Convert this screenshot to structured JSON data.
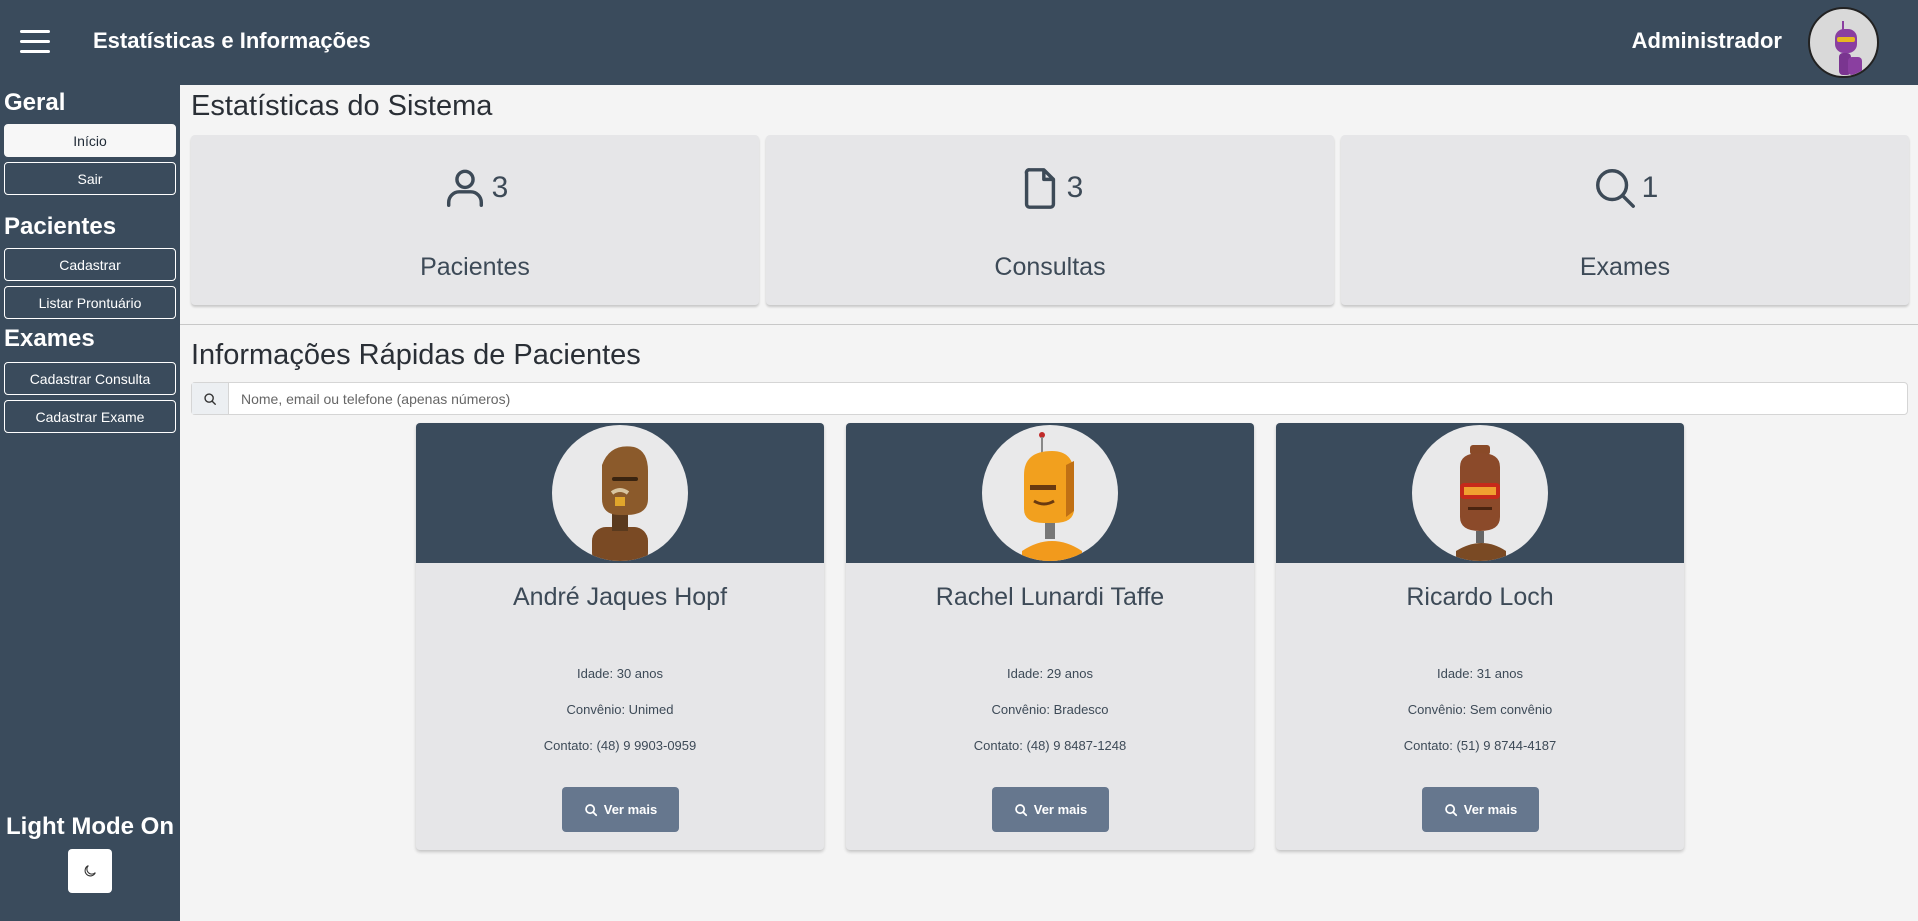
{
  "header": {
    "title": "Estatísticas e Informações",
    "user_name": "Administrador"
  },
  "sidebar": {
    "sections": [
      {
        "heading": "Geral",
        "items": [
          {
            "label": "Início",
            "active": true
          },
          {
            "label": "Sair"
          }
        ]
      },
      {
        "heading": "Pacientes",
        "items": [
          {
            "label": "Cadastrar"
          },
          {
            "label": "Listar Prontuário"
          }
        ]
      },
      {
        "heading": "Exames",
        "items": [
          {
            "label": "Cadastrar Consulta"
          },
          {
            "label": "Cadastrar Exame"
          }
        ]
      }
    ],
    "theme_label": "Light Mode On"
  },
  "stats": {
    "title": "Estatísticas do Sistema",
    "cards": [
      {
        "icon": "user-icon",
        "value": "3",
        "label": "Pacientes"
      },
      {
        "icon": "file-icon",
        "value": "3",
        "label": "Consultas"
      },
      {
        "icon": "search-icon",
        "value": "1",
        "label": "Exames"
      }
    ]
  },
  "patients": {
    "title": "Informações Rápidas de Pacientes",
    "search_placeholder": "Nome, email ou telefone (apenas números)",
    "button_label": "Ver mais",
    "cards": [
      {
        "name": "André Jaques Hopf",
        "age": "Idade: 30 anos",
        "insurance": "Convênio: Unimed",
        "contact": "Contato: (48) 9 9903-0959"
      },
      {
        "name": "Rachel Lunardi Taffe",
        "age": "Idade: 29 anos",
        "insurance": "Convênio: Bradesco",
        "contact": "Contato: (48) 9 8487-1248"
      },
      {
        "name": "Ricardo Loch",
        "age": "Idade: 31 anos",
        "insurance": "Convênio: Sem convênio",
        "contact": "Contato: (51) 9 8744-4187"
      }
    ]
  },
  "colors": {
    "navy": "#3a4b5c",
    "card_bg": "#e6e6e8",
    "button": "#66778e"
  }
}
